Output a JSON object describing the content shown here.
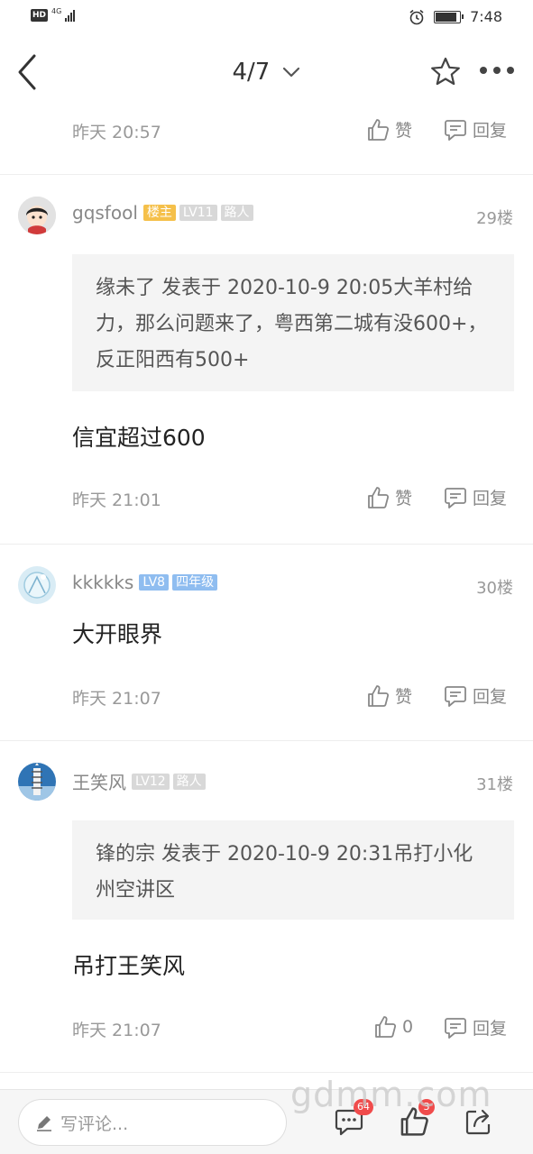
{
  "status_bar": {
    "hd": "HD",
    "network": "4G",
    "time": "7:48"
  },
  "nav": {
    "page_indicator": "4/7"
  },
  "posts": [
    {
      "time": "昨天 20:57",
      "like_label": "赞",
      "reply_label": "回复"
    },
    {
      "username": "gqsfool",
      "badges": [
        "楼主",
        "LV11",
        "路人"
      ],
      "floor": "29楼",
      "quote": "缘未了 发表于 2020-10-9 20:05大羊村给力，那么问题来了，粤西第二城有没600+，反正阳西有500+",
      "content": "信宜超过600",
      "time": "昨天 21:01",
      "like_label": "赞",
      "reply_label": "回复"
    },
    {
      "username": "kkkkks",
      "badges": [
        "LV8",
        "四年级"
      ],
      "floor": "30楼",
      "content": "大开眼界",
      "time": "昨天 21:07",
      "like_label": "赞",
      "reply_label": "回复"
    },
    {
      "username": "王笑风",
      "badges": [
        "LV12",
        "路人"
      ],
      "floor": "31楼",
      "quote": "锋的宗 发表于 2020-10-9 20:31吊打小化州空讲区",
      "content": "吊打王笑风",
      "time": "昨天 21:07",
      "like_label": "0",
      "reply_label": "回复"
    }
  ],
  "bottom_bar": {
    "comment_placeholder": "写评论...",
    "comments_count": "64",
    "likes_count": "3"
  },
  "watermark": "gdmm.com",
  "colors": {
    "badge_owner": "#f5c04a",
    "badge_grey": "#d8d8d8",
    "badge_blue": "#8fbdf0",
    "notify_red": "#f04b4b"
  },
  "icons": [
    "back-icon",
    "chevron-down-icon",
    "star-icon",
    "more-icon",
    "thumbs-up-icon",
    "reply-icon",
    "pencil-icon",
    "comment-icon",
    "share-icon",
    "alarm-icon",
    "battery-icon",
    "signal-icon"
  ]
}
